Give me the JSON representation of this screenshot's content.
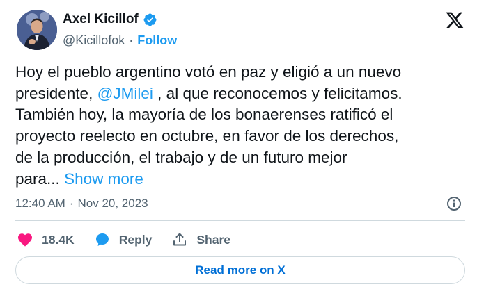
{
  "author": {
    "display_name": "Axel Kicillof",
    "handle": "@Kicillofok",
    "separator": "·",
    "follow_label": "Follow"
  },
  "tweet": {
    "line1": "Hoy el pueblo argentino votó en paz y eligió a un nuevo",
    "line2_before": "presidente, ",
    "mention": "@JMilei",
    "line2_after": " , al que reconocemos y felicitamos.",
    "line3": "También hoy, la mayoría de los bonaerenses ratificó el",
    "line4": "proyecto reelecto en octubre, en favor de los derechos,",
    "line5": "de la producción, el trabajo y de un futuro mejor",
    "line6": "para...",
    "show_more": "Show more"
  },
  "meta": {
    "time": "12:40 AM",
    "separator": "·",
    "date": "Nov 20, 2023"
  },
  "actions": {
    "likes": "18.4K",
    "reply_label": "Reply",
    "share_label": "Share"
  },
  "read_more_label": "Read more on X",
  "colors": {
    "accent": "#1d9bf0",
    "like": "#f91880",
    "text": "#0f1419",
    "muted": "#536471",
    "border": "#cfd9de"
  }
}
